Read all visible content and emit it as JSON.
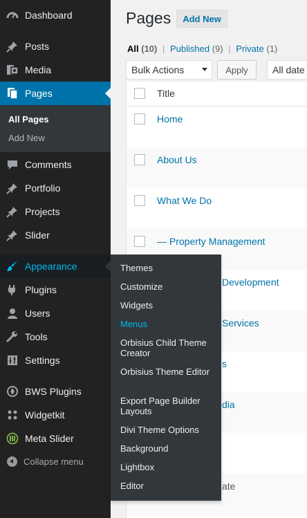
{
  "sidebar": {
    "items": [
      {
        "label": "Dashboard",
        "icon": "dashboard-icon"
      },
      {
        "label": "Posts",
        "icon": "pin-icon"
      },
      {
        "label": "Media",
        "icon": "media-icon"
      },
      {
        "label": "Pages",
        "icon": "pages-icon"
      },
      {
        "label": "Comments",
        "icon": "comments-icon"
      },
      {
        "label": "Portfolio",
        "icon": "pin-icon"
      },
      {
        "label": "Projects",
        "icon": "pin-icon"
      },
      {
        "label": "Slider",
        "icon": "pin-icon"
      },
      {
        "label": "Appearance",
        "icon": "appearance-icon"
      },
      {
        "label": "Plugins",
        "icon": "plugins-icon"
      },
      {
        "label": "Users",
        "icon": "users-icon"
      },
      {
        "label": "Tools",
        "icon": "tools-icon"
      },
      {
        "label": "Settings",
        "icon": "settings-icon"
      },
      {
        "label": "BWS Plugins",
        "icon": "bws-icon"
      },
      {
        "label": "Widgetkit",
        "icon": "widgetkit-icon"
      },
      {
        "label": "Meta Slider",
        "icon": "metaslider-icon"
      }
    ],
    "pages_submenu": [
      "All Pages",
      "Add New"
    ],
    "collapse_label": "Collapse menu"
  },
  "flyout": {
    "items": [
      "Themes",
      "Customize",
      "Widgets",
      "Menus",
      "Orbisius Child Theme Creator",
      "Orbisius Theme Editor",
      "Export Page Builder Layouts",
      "Divi Theme Options",
      "Background",
      "Lightbox",
      "Editor"
    ]
  },
  "header": {
    "title": "Pages",
    "add_new": "Add New"
  },
  "filters": {
    "all": "All",
    "all_count": "(10)",
    "sep": "|",
    "published": "Published",
    "published_count": "(9)",
    "private": "Private",
    "private_count": "(1)"
  },
  "toolbar": {
    "bulk_actions": "Bulk Actions",
    "apply": "Apply",
    "dates": "All date"
  },
  "table": {
    "column_title": "Title",
    "rows": [
      {
        "title": "Home"
      },
      {
        "title": "About Us"
      },
      {
        "title": "What We Do"
      },
      {
        "title": "— Property Management"
      },
      {
        "title": "Development"
      },
      {
        "title": "Services"
      },
      {
        "title": "s"
      },
      {
        "title": "dia"
      },
      {
        "title": ""
      },
      {
        "title": "ate"
      }
    ]
  },
  "colors": {
    "accent": "#0073aa",
    "sidebar_bg": "#222222",
    "flyout_bg": "#32373c",
    "highlight": "#00b9eb"
  }
}
